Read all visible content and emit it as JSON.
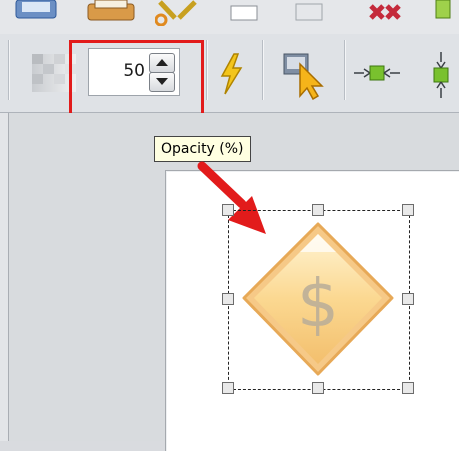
{
  "toolbar": {
    "opacity_value": "50",
    "spin_up_icon": "caret-up",
    "spin_down_icon": "caret-down",
    "tools": [
      {
        "name": "transparency-pattern-icon"
      },
      {
        "name": "lightning-icon"
      },
      {
        "name": "select-pointer-icon"
      },
      {
        "name": "center-horizontal-icon"
      },
      {
        "name": "center-vertical-icon"
      }
    ]
  },
  "tooltip": {
    "text": "Opacity (%)"
  },
  "canvas": {
    "object_icon": "dollar-diamond-sign-icon",
    "object_glyph": "$"
  },
  "annotation": {
    "highlight_color": "#e21b1b",
    "arrow_color": "#e21b1b"
  }
}
